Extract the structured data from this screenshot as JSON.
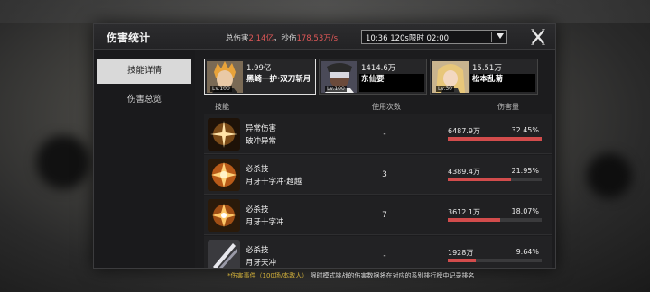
{
  "header": {
    "title": "伤害统计",
    "total_label": "总伤害",
    "total_value": "2.14亿",
    "sep": "，",
    "dps_label": "秒伤",
    "dps_value": "178.53万/s"
  },
  "battle_select": {
    "value": "10:36 120s限时 02:00"
  },
  "sidebar": {
    "tabs": [
      {
        "label": "技能详情",
        "active": true
      },
      {
        "label": "伤害总览",
        "active": false
      }
    ]
  },
  "characters": [
    {
      "damage": "1.99亿",
      "name": "黑崎一护·双刀斩月",
      "level": "Lv.100",
      "active": true
    },
    {
      "damage": "1414.6万",
      "name": "东仙要",
      "level": "Lv.100",
      "active": false
    },
    {
      "damage": "15.51万",
      "name": "松本乱菊",
      "level": "Lv.30",
      "active": false
    }
  ],
  "table": {
    "headers": {
      "skill": "技能",
      "uses": "使用次数",
      "damage": "伤害量"
    },
    "rows": [
      {
        "type": "异常伤害",
        "name": "破冲异常",
        "uses": "-",
        "damage": "6487.9万",
        "percent": "32.45%",
        "fraction": 1.0,
        "icon": "spark-icon"
      },
      {
        "type": "必杀技",
        "name": "月牙十字冲·超越",
        "uses": "3",
        "damage": "4389.4万",
        "percent": "21.95%",
        "fraction": 0.676,
        "icon": "cross-burst-icon"
      },
      {
        "type": "必杀技",
        "name": "月牙十字冲",
        "uses": "7",
        "damage": "3612.1万",
        "percent": "18.07%",
        "fraction": 0.557,
        "icon": "cross-burst-icon"
      },
      {
        "type": "必杀技",
        "name": "月牙天冲",
        "uses": "-",
        "damage": "1928万",
        "percent": "9.64%",
        "fraction": 0.297,
        "icon": "slash-icon"
      }
    ]
  },
  "footer": {
    "highlight": "*伤害事件（100场/本敌人）",
    "text": "限时模式挑战的伤害数据将在对应的系别排行榜中记录排名"
  },
  "colors": {
    "accent_red": "#e05858",
    "bar_red": "#d24c4c",
    "panel_bg": "#1c1c1e"
  }
}
